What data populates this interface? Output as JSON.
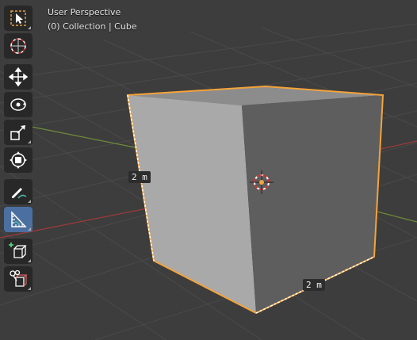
{
  "viewport": {
    "view_name": "User Perspective",
    "collection_info": "(0) Collection | Cube"
  },
  "toolbar": {
    "tools": [
      {
        "name": "select-box-tool",
        "icon": "select-box-icon",
        "active": false
      },
      {
        "name": "cursor-tool",
        "icon": "cursor-icon",
        "active": false
      },
      {
        "name": "move-tool",
        "icon": "move-icon",
        "active": false
      },
      {
        "name": "rotate-tool",
        "icon": "rotate-icon",
        "active": false
      },
      {
        "name": "scale-tool",
        "icon": "scale-icon",
        "active": false
      },
      {
        "name": "transform-tool",
        "icon": "transform-icon",
        "active": false
      },
      {
        "name": "annotate-tool",
        "icon": "annotate-icon",
        "active": false
      },
      {
        "name": "measure-tool",
        "icon": "measure-icon",
        "active": true
      },
      {
        "name": "add-cube-tool",
        "icon": "add-cube-icon",
        "active": false
      },
      {
        "name": "snap-tool",
        "icon": "snap-icon",
        "active": false
      }
    ]
  },
  "measurements": {
    "left_edge": "2 m",
    "bottom_edge": "2 m"
  },
  "colors": {
    "background": "#3d3d3d",
    "grid_line": "#4a4a4a",
    "x_axis": "#9e3a3a",
    "y_axis": "#6e8d3b",
    "selection_outline": "#f5a33a",
    "active_tool": "#4b6fa0",
    "toolbar_button": "#282828"
  }
}
